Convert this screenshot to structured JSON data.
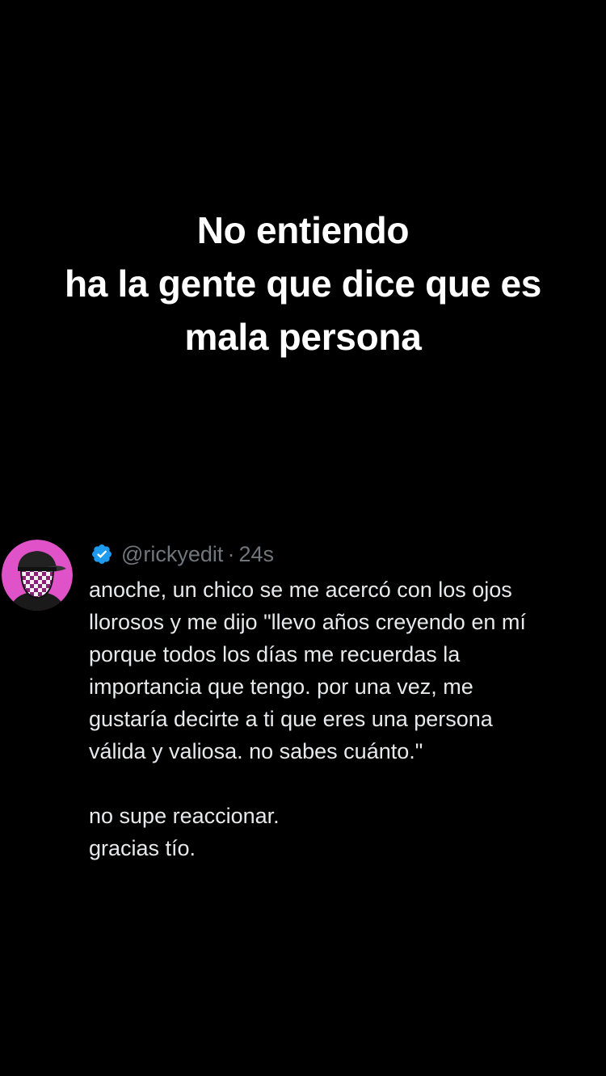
{
  "caption": {
    "lines": [
      "No entiendo",
      "ha la gente que dice que es",
      "mala persona"
    ]
  },
  "tweet": {
    "handle": "@rickyedit",
    "separator": "·",
    "time": "24s",
    "paragraph1": [
      "anoche, un chico se me acercó con los ojos",
      "llorosos y me dijo \"llevo años creyendo en mí",
      "porque todos los días me recuerdas la",
      "importancia que tengo. por una vez, me",
      "gustaría decirte a ti que eres una persona",
      "válida y valiosa. no sabes cuánto.\""
    ],
    "paragraph2": [
      "no supe reaccionar.",
      "gracias tío."
    ]
  },
  "icons": {
    "avatar": "avatar-pink-checkered-face-icon",
    "verified": "verified-badge-icon"
  },
  "colors": {
    "background": "#000000",
    "caption_text": "#ffffff",
    "tweet_text": "#e7e9ea",
    "meta_text": "#71767b",
    "verified_blue": "#1d9bf0",
    "avatar_pink": "#e052c8"
  }
}
